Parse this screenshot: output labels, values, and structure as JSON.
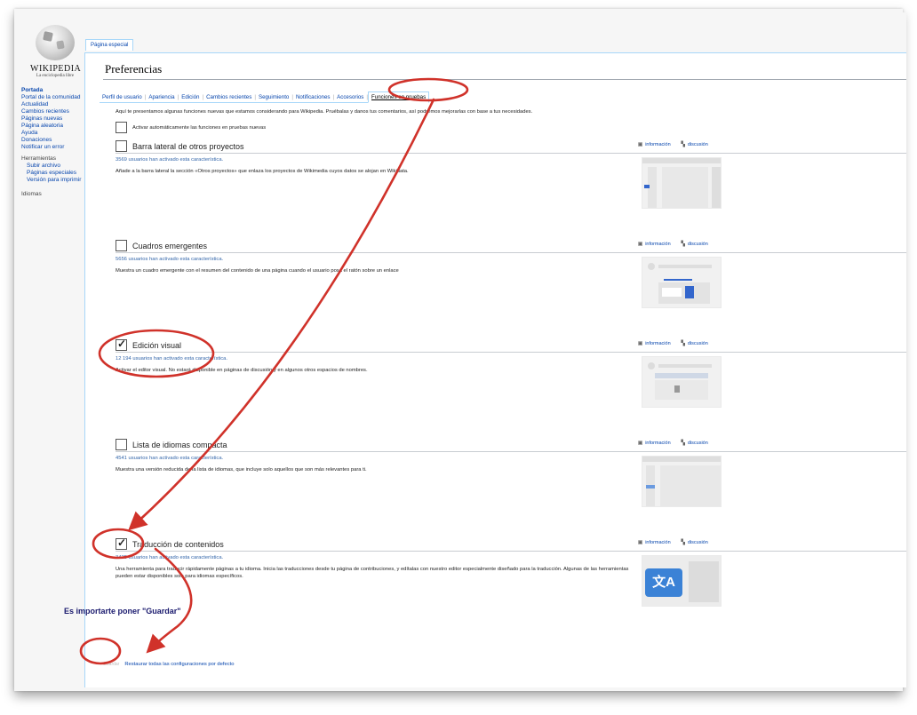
{
  "logo": {
    "wordmark": "WIKIPEDIA",
    "tagline": "La enciclopedia libre"
  },
  "sidebar": {
    "nav": [
      "Portada",
      "Portal de la comunidad",
      "Actualidad",
      "Cambios recientes",
      "Páginas nuevas",
      "Página aleatoria",
      "Ayuda",
      "Donaciones",
      "Notificar un error"
    ],
    "tools_heading": "Herramientas",
    "tools": [
      "Subir archivo",
      "Páginas especiales",
      "Versión para imprimir"
    ],
    "languages": "Idiomas"
  },
  "special_tab": "Página especial",
  "page_title": "Preferencias",
  "tabs": [
    "Perfil de usuario",
    "Apariencia",
    "Edición",
    "Cambios recientes",
    "Seguimiento",
    "Notificaciones",
    "Accesorios",
    "Funciones en pruebas"
  ],
  "intro": "Aquí te presentamos algunas funciones nuevas que estamos considerando para Wikipedia. Pruébalas y danos tus comentarios, así podremos mejorarlas con base a tus necesidades.",
  "auto_enable_label": "Activar automáticamente las funciones en pruebas nuevas",
  "links": {
    "info": "información",
    "discussion": "discusión"
  },
  "features": [
    {
      "title": "Barra lateral de otros proyectos",
      "checked": false,
      "users": "3569 usuarios han activado esta característica.",
      "desc": "Añade a la barra lateral la sección «Otros proyectos» que enlaza los proyectos de Wikimedia cuyos datos se alojan en Wikidata."
    },
    {
      "title": "Cuadros emergentes",
      "checked": false,
      "users": "5656 usuarios han activado esta característica.",
      "desc": "Muestra un cuadro emergente con el resumen del contenido de una página cuando el usuario posa el ratón sobre un enlace"
    },
    {
      "title": "Edición visual",
      "checked": true,
      "users": "12 194 usuarios han activado esta característica.",
      "desc": "Activar el editor visual. No estará disponible en páginas de discusión y en algunos otros espacios de nombres."
    },
    {
      "title": "Lista de idiomas compacta",
      "checked": false,
      "users": "4541 usuarios han activado esta característica.",
      "desc": "Muestra una versión reducida de la lista de idiomas, que incluye solo aquellos que son más relevantes para ti."
    },
    {
      "title": "Traducción de contenidos",
      "checked": true,
      "users": "3435 usuarios han activado esta característica.",
      "desc": "Una herramienta para traducir rápidamente páginas a tu idioma. Inicia las traducciones desde tu página de contribuciones, y edítalas con nuestro editor especialmente diseñado para la traducción. Algunas de las herramientas pueden estar disponibles solo para idiomas específicos."
    }
  ],
  "save_label": "Guardar",
  "reset_label": "Restaurar todas las configuraciones por defecto",
  "annotation": "Es importarte poner \"Guardar\"",
  "colors": {
    "link": "#0645ad",
    "annotation_red": "#d0322a",
    "accent_blue": "#3366cc"
  }
}
